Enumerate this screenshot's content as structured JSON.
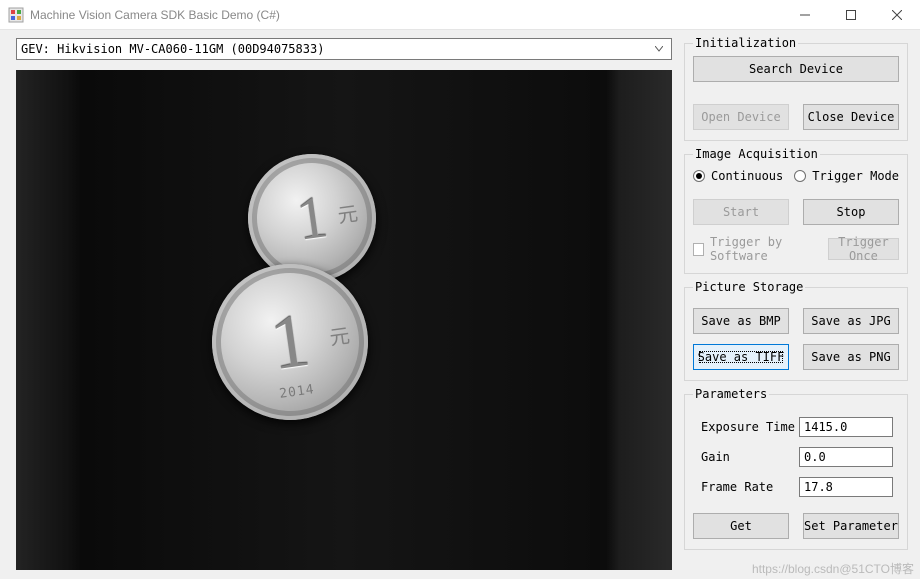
{
  "window": {
    "title": "Machine Vision Camera SDK Basic Demo (C#)"
  },
  "device_select": {
    "value": "GEV: Hikvision MV-CA060-11GM (00D94075833)"
  },
  "preview": {
    "coin_year": "2014",
    "coin_denom": "1",
    "coin_unit": "元"
  },
  "init": {
    "legend": "Initialization",
    "search": "Search Device",
    "open": "Open Device",
    "close": "Close Device"
  },
  "acq": {
    "legend": "Image Acquisition",
    "continuous": "Continuous",
    "trigger_mode": "Trigger Mode",
    "mode_selected": "continuous",
    "start": "Start",
    "stop": "Stop",
    "trigger_sw": "Trigger by Software",
    "trigger_sw_checked": false,
    "trigger_once": "Trigger Once"
  },
  "storage": {
    "legend": "Picture Storage",
    "bmp": "Save as BMP",
    "jpg": "Save as JPG",
    "tiff": "Save as TIFF",
    "png": "Save as PNG",
    "selected": "tiff"
  },
  "params": {
    "legend": "Parameters",
    "exposure_label": "Exposure Time",
    "exposure_value": "1415.0",
    "gain_label": "Gain",
    "gain_value": "0.0",
    "fps_label": "Frame Rate",
    "fps_value": "17.8",
    "get": "Get",
    "set": "Set Parameter"
  },
  "watermark": "https://blog.csdn@51CTO博客"
}
